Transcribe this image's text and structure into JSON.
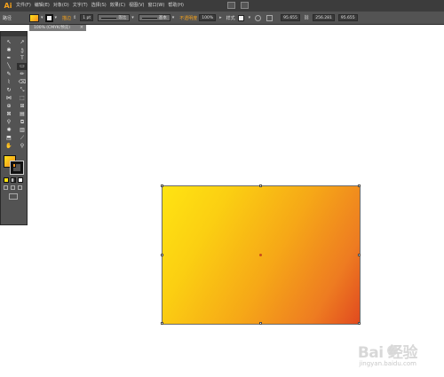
{
  "app": {
    "logo": "Ai"
  },
  "menu": {
    "items": [
      "文件(F)",
      "编辑(E)",
      "对象(O)",
      "文字(T)",
      "选择(S)",
      "效果(C)",
      "视图(V)",
      "窗口(W)",
      "帮助(H)"
    ]
  },
  "control_bar": {
    "path_label": "路径",
    "stroke_label": "描边",
    "stroke_weight": "1 pt",
    "stroke_profile": "等比",
    "brush_definition": "基本",
    "opacity_label": "不透明度",
    "opacity_value": "100%",
    "style_label": "样式",
    "x_value": "95.655",
    "w_value": "256.281",
    "h_value": "95.655"
  },
  "document": {
    "tab_title": "100% (CMYK/预览)",
    "close_glyph": "×"
  },
  "toolbox": {
    "tools": [
      {
        "name": "selection-tool",
        "glyph": "↖"
      },
      {
        "name": "direct-selection-tool",
        "glyph": "↗"
      },
      {
        "name": "magic-wand-tool",
        "glyph": "✱"
      },
      {
        "name": "lasso-tool",
        "glyph": "ე"
      },
      {
        "name": "pen-tool",
        "glyph": "✒"
      },
      {
        "name": "type-tool",
        "glyph": "T"
      },
      {
        "name": "line-segment-tool",
        "glyph": "╲"
      },
      {
        "name": "rectangle-tool",
        "glyph": "▭"
      },
      {
        "name": "paintbrush-tool",
        "glyph": "✎"
      },
      {
        "name": "pencil-tool",
        "glyph": "✏"
      },
      {
        "name": "blob-brush-tool",
        "glyph": "⌇"
      },
      {
        "name": "eraser-tool",
        "glyph": "⌫"
      },
      {
        "name": "rotate-tool",
        "glyph": "↻"
      },
      {
        "name": "scale-tool",
        "glyph": "⤡"
      },
      {
        "name": "width-tool",
        "glyph": "⋈"
      },
      {
        "name": "free-transform-tool",
        "glyph": "⬚"
      },
      {
        "name": "shape-builder-tool",
        "glyph": "⊕"
      },
      {
        "name": "perspective-grid-tool",
        "glyph": "⊞"
      },
      {
        "name": "mesh-tool",
        "glyph": "⊠"
      },
      {
        "name": "gradient-tool",
        "glyph": "▤"
      },
      {
        "name": "eyedropper-tool",
        "glyph": "⚲"
      },
      {
        "name": "blend-tool",
        "glyph": "⧉"
      },
      {
        "name": "symbol-sprayer-tool",
        "glyph": "✺"
      },
      {
        "name": "column-graph-tool",
        "glyph": "▥"
      },
      {
        "name": "artboard-tool",
        "glyph": "⬒"
      },
      {
        "name": "slice-tool",
        "glyph": "⟋"
      },
      {
        "name": "hand-tool",
        "glyph": "✋"
      },
      {
        "name": "zoom-tool",
        "glyph": "⚲"
      }
    ]
  },
  "colors": {
    "fill_start": "#ffe412",
    "fill_end": "#e14a1f",
    "ui_dark": "#535353",
    "accent_orange": "#f4a11c"
  },
  "watermark": {
    "logo": "Bai 经验",
    "url": "jingyan.baidu.com"
  }
}
